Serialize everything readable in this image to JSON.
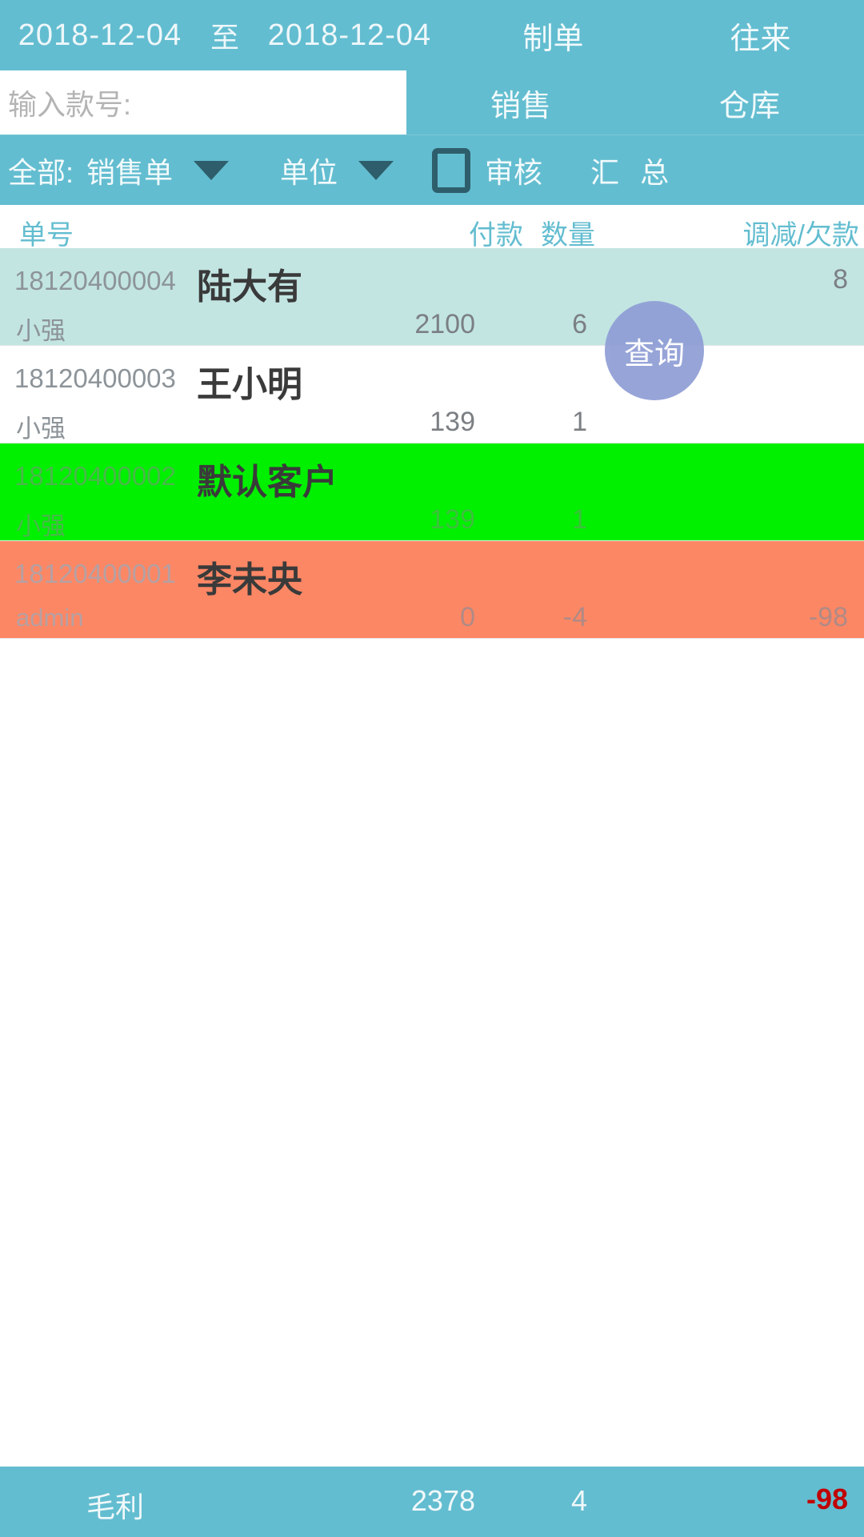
{
  "topbar": {
    "date_from": "2018-12-04",
    "date_separator": "至",
    "date_to": "2018-12-04",
    "tabs": [
      {
        "label": "制单"
      },
      {
        "label": "往来"
      }
    ]
  },
  "search": {
    "placeholder": "输入款号:",
    "value": "",
    "tabs": [
      {
        "label": "销售"
      },
      {
        "label": "仓库"
      }
    ]
  },
  "filterbar": {
    "all_label": "全部:",
    "doc_type": "销售单",
    "unit": "单位",
    "audit_checked": false,
    "audit_label": "审核",
    "summary_label": "汇 总"
  },
  "table": {
    "headers": {
      "no": "单号",
      "payment": "付款",
      "quantity": "数量",
      "adjust": "调减/欠款"
    },
    "rows": [
      {
        "code": "18120400004",
        "name": "陆大有",
        "user": "小强",
        "payment": "2100",
        "quantity": "6",
        "adjust_top": "8",
        "adjust_bottom": "",
        "style": "r-sel"
      },
      {
        "code": "18120400003",
        "name": "王小明",
        "user": "小强",
        "payment": "139",
        "quantity": "1",
        "adjust_top": "",
        "adjust_bottom": "",
        "style": "r-white"
      },
      {
        "code": "18120400002",
        "name": "默认客户",
        "user": "小强",
        "payment": "139",
        "quantity": "1",
        "adjust_top": "",
        "adjust_bottom": "",
        "style": "r-green"
      },
      {
        "code": "18120400001",
        "name": "李未央",
        "user": "admin",
        "payment": "0",
        "quantity": "-4",
        "adjust_top": "",
        "adjust_bottom": "-98",
        "style": "r-salmon"
      }
    ]
  },
  "fab": {
    "label": "查询"
  },
  "summary": {
    "label": "毛利",
    "payment": "2378",
    "quantity": "4",
    "adjust": "-98"
  },
  "colors": {
    "teal": "#63bdd0",
    "row_selected": "#c2e5e2",
    "row_green": "#00f000",
    "row_salmon": "#fc8765",
    "fab": "#8f9dd5",
    "negative": "#c00000"
  }
}
